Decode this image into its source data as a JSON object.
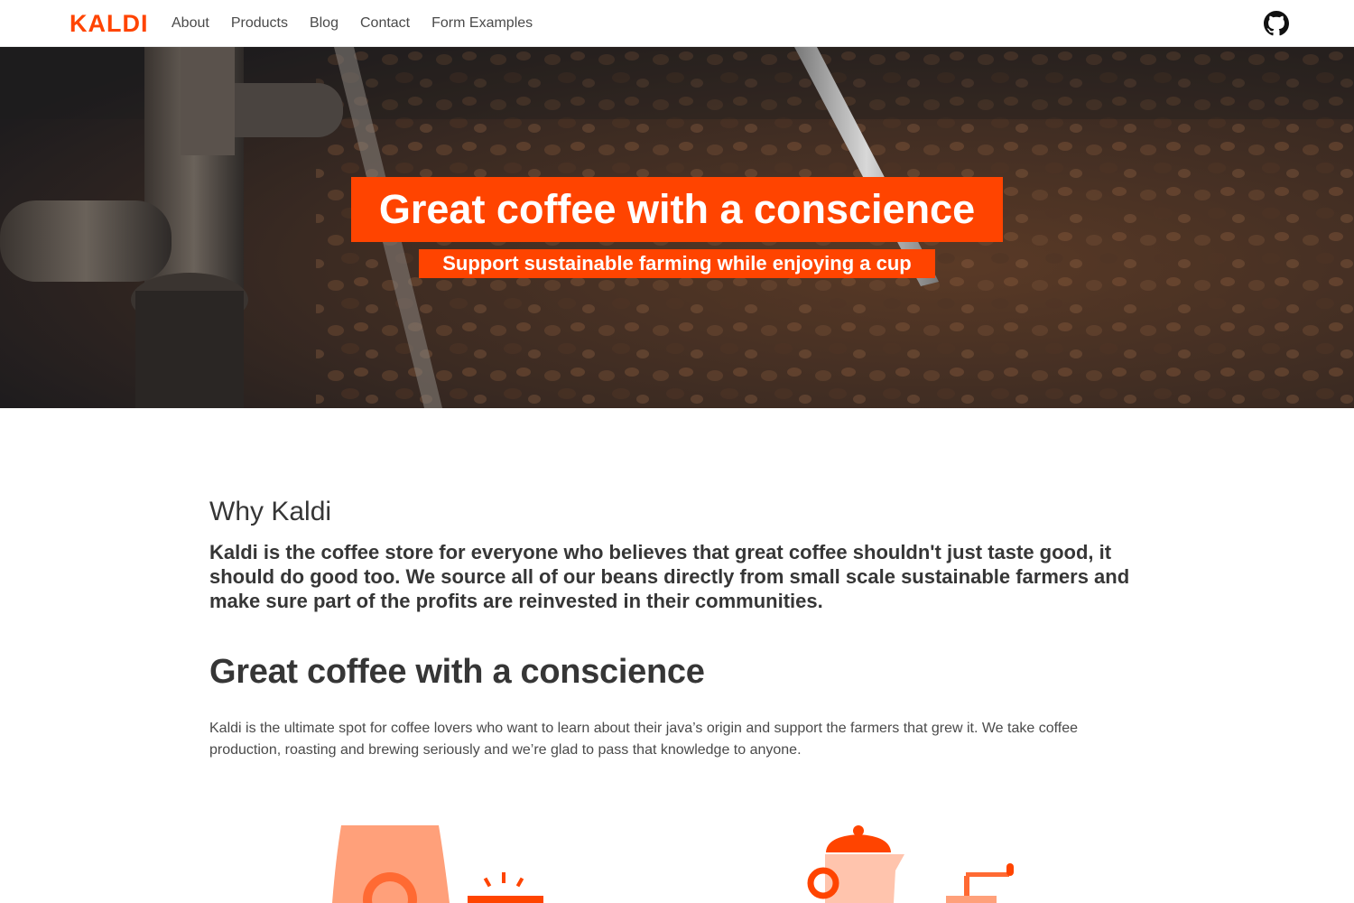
{
  "nav": {
    "logo": "KALDI",
    "links": [
      "About",
      "Products",
      "Blog",
      "Contact",
      "Form Examples"
    ]
  },
  "hero": {
    "title": "Great coffee with a conscience",
    "subtitle": "Support sustainable farming while enjoying a cup"
  },
  "why": {
    "title": "Why Kaldi",
    "text": "Kaldi is the coffee store for everyone who believes that great coffee shouldn't just taste good, it should do good too. We source all of our beans directly from small scale sustainable farmers and make sure part of the profits are reinvested in their communities."
  },
  "conscience": {
    "title": "Great coffee with a conscience",
    "text": "Kaldi is the ultimate spot for coffee lovers who want to learn about their java’s origin and support the farmers that grew it. We take coffee production, roasting and brewing seriously and we’re glad to pass that knowledge to anyone."
  },
  "colors": {
    "accent": "#ff4400",
    "accent_light": "#ffa07a",
    "text": "#363636"
  },
  "icons": [
    "github-icon",
    "coffee-bag-icon",
    "roaster-icon",
    "coffee-pot-icon",
    "grinder-icon"
  ]
}
